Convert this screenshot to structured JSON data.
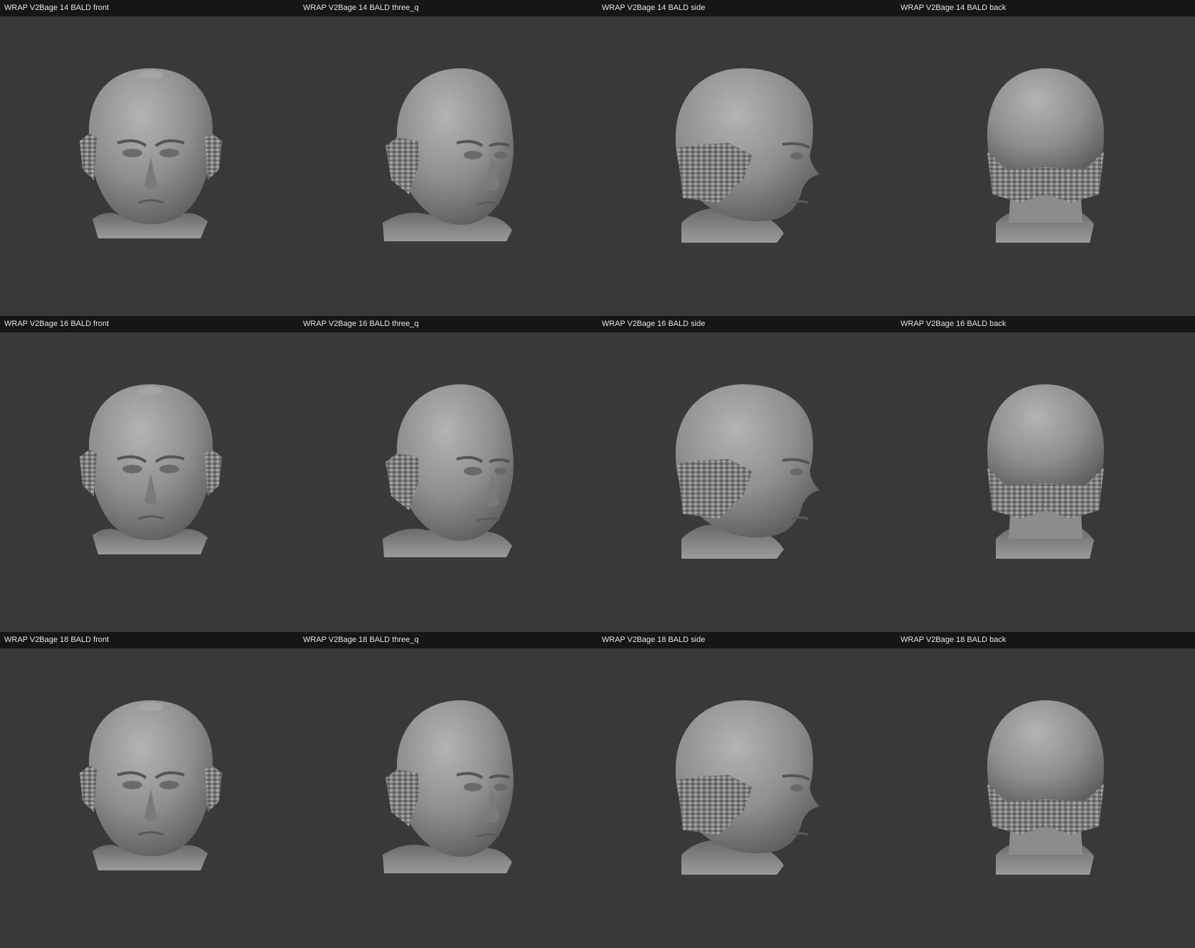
{
  "renders": [
    {
      "label": "WRAP V2Bage 14 BALD front",
      "age": 14,
      "view": "front"
    },
    {
      "label": "WRAP V2Bage 14 BALD three_q",
      "age": 14,
      "view": "three_q"
    },
    {
      "label": "WRAP V2Bage 14 BALD side",
      "age": 14,
      "view": "side"
    },
    {
      "label": "WRAP V2Bage 14 BALD back",
      "age": 14,
      "view": "back"
    },
    {
      "label": "WRAP V2Bage 16 BALD front",
      "age": 16,
      "view": "front"
    },
    {
      "label": "WRAP V2Bage 16 BALD three_q",
      "age": 16,
      "view": "three_q"
    },
    {
      "label": "WRAP V2Bage 16 BALD side",
      "age": 16,
      "view": "side"
    },
    {
      "label": "WRAP V2Bage 16 BALD back",
      "age": 16,
      "view": "back"
    },
    {
      "label": "WRAP V2Bage 18 BALD front",
      "age": 18,
      "view": "front"
    },
    {
      "label": "WRAP V2Bage 18 BALD three_q",
      "age": 18,
      "view": "three_q"
    },
    {
      "label": "WRAP V2Bage 18 BALD side",
      "age": 18,
      "view": "side"
    },
    {
      "label": "WRAP V2Bage 18 BALD back",
      "age": 18,
      "view": "back"
    }
  ],
  "colors": {
    "background": "#393939",
    "label_bar": "#161616",
    "label_text": "#e4e4e4",
    "mesh": "#8e8e8e"
  }
}
